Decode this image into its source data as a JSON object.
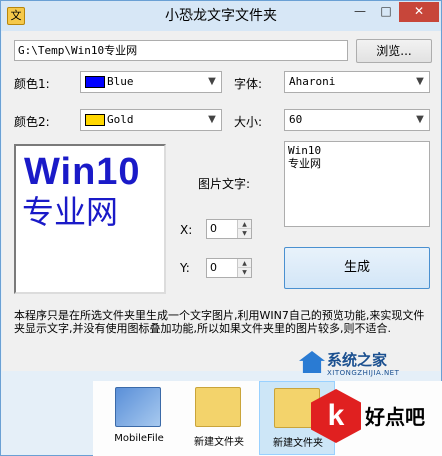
{
  "window": {
    "title": "小恐龙文字文件夹",
    "icon_glyph": "文",
    "min_glyph": "—",
    "max_glyph": "□",
    "close_glyph": "✕"
  },
  "path": {
    "value": "G:\\Temp\\Win10专业网",
    "browse_label": "浏览..."
  },
  "color1": {
    "label": "颜色1:",
    "value": "Blue",
    "swatch": "#0000ff"
  },
  "color2": {
    "label": "颜色2:",
    "value": "Gold",
    "swatch": "#ffd700"
  },
  "font": {
    "label": "字体:",
    "value": "Aharoni"
  },
  "size": {
    "label": "大小:",
    "value": "60"
  },
  "preview": {
    "line1": "Win10",
    "line2": "专业网",
    "text_color": "#1a1ac8"
  },
  "image_text": {
    "label": "图片文字:",
    "lines": [
      "Win10",
      "专业网"
    ]
  },
  "x": {
    "label": "X:",
    "value": "0"
  },
  "y": {
    "label": "Y:",
    "value": "0"
  },
  "generate_label": "生成",
  "description": "本程序只是在所选文件夹里生成一个文字图片,利用WIN7自己的预览功能,来实现文件夹显示文字,并没有使用图标叠加功能,所以如果文件夹里的图片较多,则不适合.",
  "explorer": {
    "items": [
      {
        "name": "MobileFile",
        "icon": "image-folder-icon"
      },
      {
        "name": "新建文件夹",
        "icon": "folder-icon"
      },
      {
        "name": "新建文件夹",
        "icon": "folder-icon"
      }
    ]
  },
  "watermarks": {
    "site_name": "系统之家",
    "site_url": "XITONGZHIJIA.NET",
    "logo_letter": "k",
    "haodian": "好点吧"
  },
  "icons": {
    "dropdown": "chevron-down-icon",
    "spin_up": "spin-up-icon",
    "spin_down": "spin-down-icon"
  }
}
